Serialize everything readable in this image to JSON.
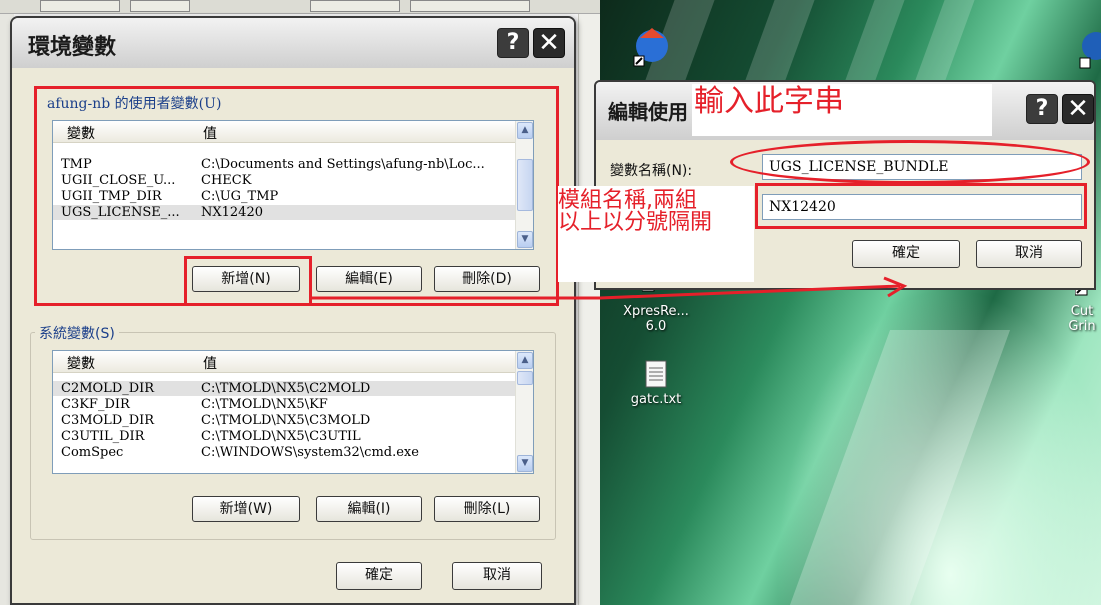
{
  "env_dialog": {
    "title": "環境變數",
    "help_glyph": "?",
    "close_glyph": "✕",
    "user_group_label": "afung-nb 的使用者變數(U)",
    "columns": [
      "變數",
      "值"
    ],
    "user_vars": [
      {
        "name": "TMP",
        "value": "C:\\Documents and Settings\\afung-nb\\Loc..."
      },
      {
        "name": "UGII_CLOSE_U...",
        "value": "CHECK"
      },
      {
        "name": "UGII_TMP_DIR",
        "value": "C:\\UG_TMP"
      },
      {
        "name": "UGS_LICENSE_...",
        "value": "NX12420"
      }
    ],
    "user_buttons": {
      "new": "新增(N)",
      "edit": "編輯(E)",
      "delete": "刪除(D)"
    },
    "system_group_label": "系統變數(S)",
    "system_vars": [
      {
        "name": "C2MOLD_DIR",
        "value": "C:\\TMOLD\\NX5\\C2MOLD"
      },
      {
        "name": "C3KF_DIR",
        "value": "C:\\TMOLD\\NX5\\KF"
      },
      {
        "name": "C3MOLD_DIR",
        "value": "C:\\TMOLD\\NX5\\C3MOLD"
      },
      {
        "name": "C3UTIL_DIR",
        "value": "C:\\TMOLD\\NX5\\C3UTIL"
      },
      {
        "name": "ComSpec",
        "value": "C:\\WINDOWS\\system32\\cmd.exe"
      }
    ],
    "system_buttons": {
      "new": "新增(W)",
      "edit": "編輯(I)",
      "delete": "刪除(L)"
    },
    "ok": "確定",
    "cancel": "取消"
  },
  "edit_dialog": {
    "title": "編輯使用",
    "help_glyph": "?",
    "close_glyph": "✕",
    "name_label": "變數名稱(N):",
    "name_value": "UGS_LICENSE_BUNDLE",
    "value_value": "NX12420",
    "ok": "確定",
    "cancel": "取消"
  },
  "annotations": {
    "input_hint": "輸入此字串",
    "module_hint_line1": "模組名稱,兩組",
    "module_hint_line2": "以上以分號隔開",
    "color": "#e5202a"
  },
  "desktop": {
    "icon_label_1": "XpresRe...",
    "icon_label_1b": "6.0",
    "icon_label_2": "gatc.txt",
    "icon_label_3": "Cut",
    "icon_label_3b": "Grin"
  }
}
